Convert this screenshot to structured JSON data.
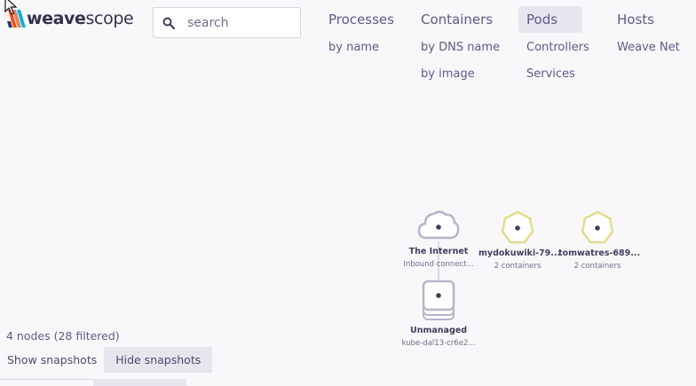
{
  "logo": {
    "part1": "weave",
    "part2": "scope"
  },
  "search": {
    "placeholder": "search"
  },
  "topologies": [
    {
      "label": "Processes",
      "subs": [
        "by name"
      ],
      "active": false
    },
    {
      "label": "Containers",
      "subs": [
        "by DNS name",
        "by image"
      ],
      "active": false
    },
    {
      "label": "Pods",
      "subs": [
        "Controllers",
        "Services"
      ],
      "active": true
    },
    {
      "label": "Hosts",
      "subs": [
        "Weave Net"
      ],
      "active": false
    }
  ],
  "nodes": [
    {
      "label": "The Internet",
      "sub": "Inbound connect...",
      "shape": "cloud"
    },
    {
      "label": "mydokuwiki-79...",
      "sub": "2 containers",
      "shape": "heptagon"
    },
    {
      "label": "tomwatres-689...",
      "sub": "2 containers",
      "shape": "heptagon"
    },
    {
      "label": "Unmanaged",
      "sub": "kube-dal13-cr6e2...",
      "shape": "stack"
    }
  ],
  "status": "4 nodes (28 filtered)",
  "snapshots": {
    "show": "Show snapshots",
    "hide": "Hide snapshots"
  },
  "colors": {
    "accent": "#5b5b88",
    "pod_stroke": "#e2dc8a",
    "internet_stroke": "#b5b5cc",
    "active_bg": "#e6e6ee",
    "logo_red": "#ff4b19",
    "logo_blue": "#00d2ff"
  }
}
